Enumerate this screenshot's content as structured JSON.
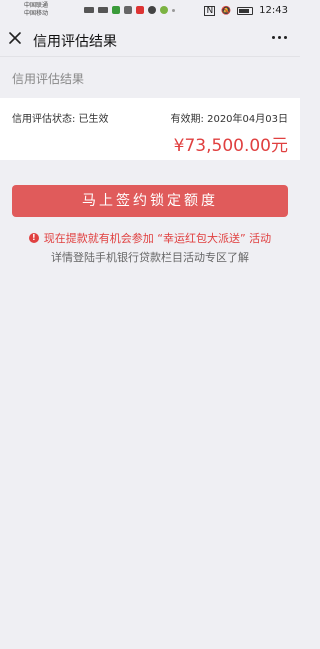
{
  "status_bar": {
    "carrier_1": "中国联通",
    "carrier_2": "中国移动",
    "time": "12:43",
    "icons": [
      "signal-icon",
      "wifi-icon",
      "app-icon",
      "notification-icon",
      "nfc-icon",
      "battery-icon"
    ]
  },
  "nav": {
    "title": "信用评估结果"
  },
  "section": {
    "header": "信用评估结果"
  },
  "card": {
    "status_label": "信用评估状态: 已生效",
    "valid_label": "有效期: 2020年04月03日",
    "amount_symbol": "¥",
    "amount_value": "73,500.00",
    "amount_unit": "元"
  },
  "button": {
    "label": "马上签约锁定额度"
  },
  "notice": {
    "line1": "现在提款就有机会参加 “幸运红包大派送” 活动",
    "line2": "详情登陆手机银行贷款栏目活动专区了解"
  },
  "colors": {
    "accent": "#e05b5b",
    "amount": "#e04040",
    "background": "#efeff3"
  }
}
